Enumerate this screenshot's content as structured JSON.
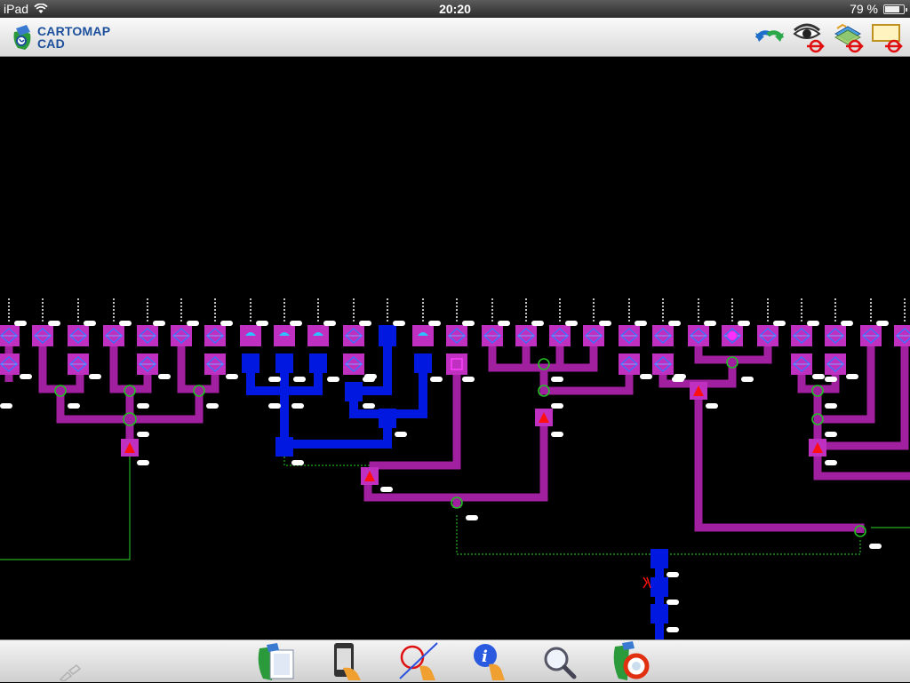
{
  "status": {
    "device": "iPad",
    "time": "20:20",
    "battery": "79 %",
    "battery_level": 0.79
  },
  "app": {
    "logo_line1": "CARTOMAP",
    "logo_line2": "CAD"
  },
  "toolbar": {
    "tools": [
      {
        "name": "undo-redo-icon"
      },
      {
        "name": "visibility-icon"
      },
      {
        "name": "layers-icon"
      },
      {
        "name": "note-icon"
      }
    ]
  },
  "bottom": {
    "tools": [
      {
        "name": "documents-icon"
      },
      {
        "name": "device-icon"
      },
      {
        "name": "select-area-icon"
      },
      {
        "name": "info-icon"
      },
      {
        "name": "search-icon"
      },
      {
        "name": "help-icon"
      }
    ]
  },
  "colors": {
    "background": "#000000",
    "pipe": "#a020a0",
    "node": "#c030c0",
    "node_inner": "#3050ff",
    "blue_pipe": "#0018e0",
    "alert": "#ff1010",
    "link": "#22b022",
    "label": "#ffffff"
  }
}
